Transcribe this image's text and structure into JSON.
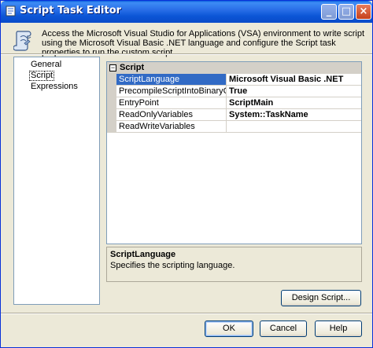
{
  "window": {
    "title": "Script Task Editor",
    "controls": {
      "minimize": "_",
      "maximize": "□",
      "close": "×"
    }
  },
  "header": {
    "icon": "script-task-icon",
    "description": "Access the Microsoft Visual Studio for Applications (VSA) environment to write script using the Microsoft Visual Basic .NET language and configure the Script task properties to run the custom script."
  },
  "nav": {
    "items": [
      {
        "label": "General",
        "selected": false
      },
      {
        "label": "Script",
        "selected": true
      },
      {
        "label": "Expressions",
        "selected": false
      }
    ]
  },
  "properties": {
    "category": "Script",
    "expander": "−",
    "rows": [
      {
        "name": "ScriptLanguage",
        "value": "Microsoft Visual Basic .NET",
        "selected": true
      },
      {
        "name": "PrecompileScriptIntoBinaryCode",
        "value": "True",
        "selected": false
      },
      {
        "name": "EntryPoint",
        "value": "ScriptMain",
        "selected": false
      },
      {
        "name": "ReadOnlyVariables",
        "value": "System::TaskName",
        "selected": false
      },
      {
        "name": "ReadWriteVariables",
        "value": "",
        "selected": false
      }
    ]
  },
  "description_panel": {
    "title": "ScriptLanguage",
    "text": "Specifies the scripting language."
  },
  "buttons": {
    "design_script": "Design Script...",
    "ok": "OK",
    "cancel": "Cancel",
    "help": "Help"
  },
  "colors": {
    "titlebar": "#0a5fdc",
    "selection": "#316ac5",
    "dialog_bg": "#ece9d8"
  }
}
